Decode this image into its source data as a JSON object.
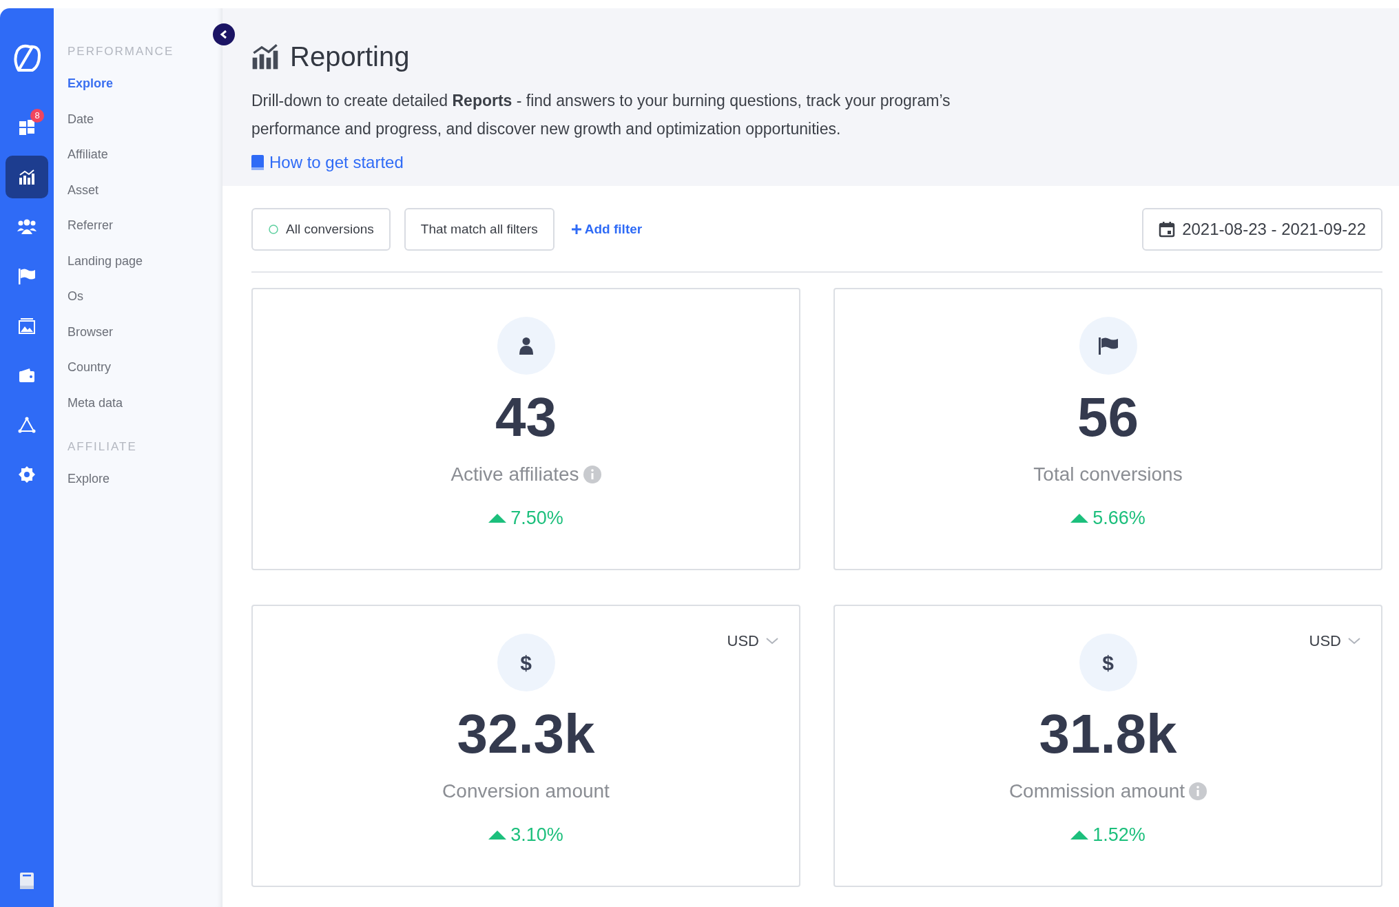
{
  "rail": {
    "items": [
      {
        "kind": "grid",
        "selected": false,
        "badge": "8"
      },
      {
        "kind": "chart",
        "selected": true
      },
      {
        "kind": "people",
        "selected": false
      },
      {
        "kind": "flag",
        "selected": false
      },
      {
        "kind": "image",
        "selected": false
      },
      {
        "kind": "wallet",
        "selected": false
      },
      {
        "kind": "network",
        "selected": false
      },
      {
        "kind": "gear",
        "selected": false
      }
    ]
  },
  "sidebar": {
    "sections": [
      {
        "title": "PERFORMANCE",
        "items": [
          {
            "label": "Explore",
            "selected": true
          },
          {
            "label": "Date",
            "selected": false
          },
          {
            "label": "Affiliate",
            "selected": false
          },
          {
            "label": "Asset",
            "selected": false
          },
          {
            "label": "Referrer",
            "selected": false
          },
          {
            "label": "Landing page",
            "selected": false
          },
          {
            "label": "Os",
            "selected": false
          },
          {
            "label": "Browser",
            "selected": false
          },
          {
            "label": "Country",
            "selected": false
          },
          {
            "label": "Meta data",
            "selected": false
          }
        ]
      },
      {
        "title": "AFFILIATE",
        "items": [
          {
            "label": "Explore",
            "selected": false
          }
        ]
      }
    ]
  },
  "header": {
    "title": "Reporting",
    "description": "Drill-down to create detailed **Reports** - find answers to your burning questions, track your program’s performance and progress, and discover new growth and optimization opportunities.",
    "link": "How to get started"
  },
  "filters": {
    "conversions": "All conversions",
    "match": "That match all filters",
    "add_filter": "Add filter",
    "date_range": "2021-08-23 - 2021-09-22"
  },
  "cards": [
    {
      "kind": "person",
      "value": "43",
      "label": "Active affiliates",
      "info": true,
      "change": "7.50%"
    },
    {
      "kind": "flag",
      "value": "56",
      "label": "Total conversions",
      "info": false,
      "change": "5.66%"
    },
    {
      "kind": "symbol",
      "symbol": "$",
      "value": "32.3k",
      "label": "Conversion amount",
      "info": false,
      "change": "3.10%",
      "currency": "USD"
    },
    {
      "kind": "symbol",
      "symbol": "$",
      "value": "31.8k",
      "label": "Commission amount",
      "info": true,
      "change": "1.52%",
      "currency": "USD"
    }
  ]
}
